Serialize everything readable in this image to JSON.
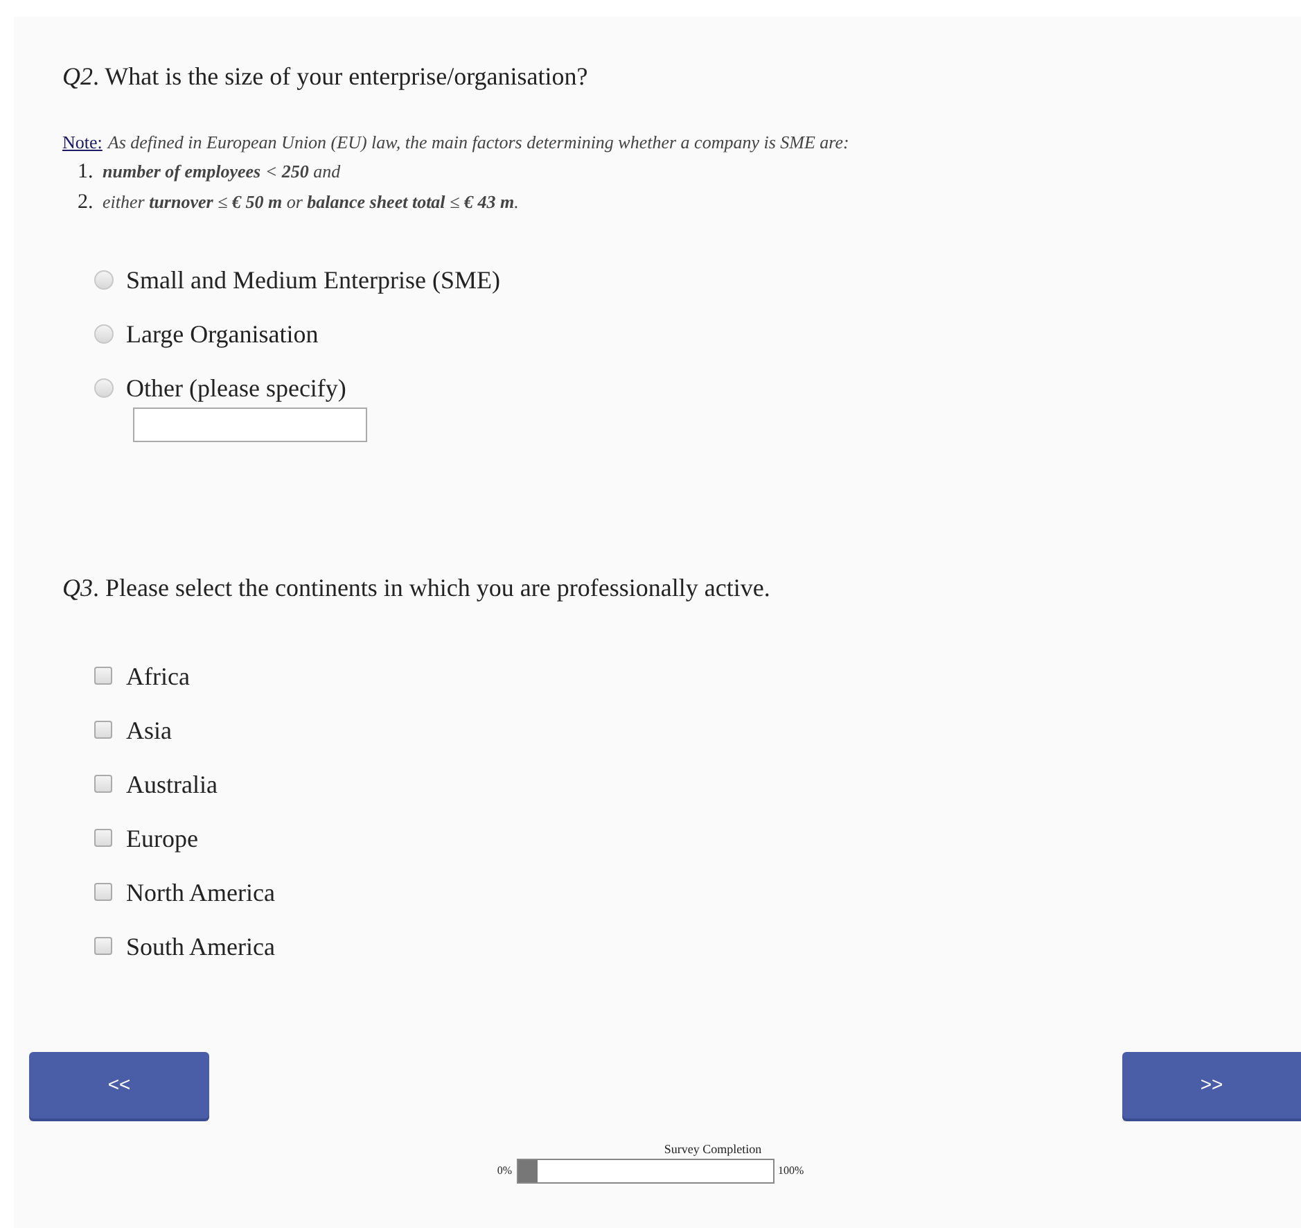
{
  "q2": {
    "question": "*Q2*. What is the size of your enterprise/organisation?",
    "note_label": "Note:",
    "note": "As defined in European Union (EU) law, the main factors determining whether a company is SME are:",
    "criteria": [
      {
        "number": "1.",
        "text": "**number of employees** < **250** and"
      },
      {
        "number": "2.",
        "text": "either **turnover** ≤ **€ 50 m** or **balance sheet total** ≤ **€ 43 m**."
      }
    ],
    "options": [
      {
        "label": "Small and Medium Enterprise (SME)",
        "selected": false
      },
      {
        "label": "Large Organisation",
        "selected": false
      },
      {
        "label": "Other (please specify)",
        "selected": false,
        "kind": "other"
      }
    ]
  },
  "q3": {
    "question": "*Q3*. Please select the continents in which you are professionally active.",
    "options": [
      {
        "label": "Africa",
        "checked": false
      },
      {
        "label": "Asia",
        "checked": false
      },
      {
        "label": "Australia",
        "checked": false
      },
      {
        "label": "Europe",
        "checked": false
      },
      {
        "label": "North America",
        "checked": false
      },
      {
        "label": "South America",
        "checked": false
      }
    ]
  },
  "nav": {
    "back": "<<",
    "next": ">>"
  },
  "progress": {
    "title": "Survey Completion",
    "min": "0%",
    "max": "100%",
    "level": 0.08
  }
}
